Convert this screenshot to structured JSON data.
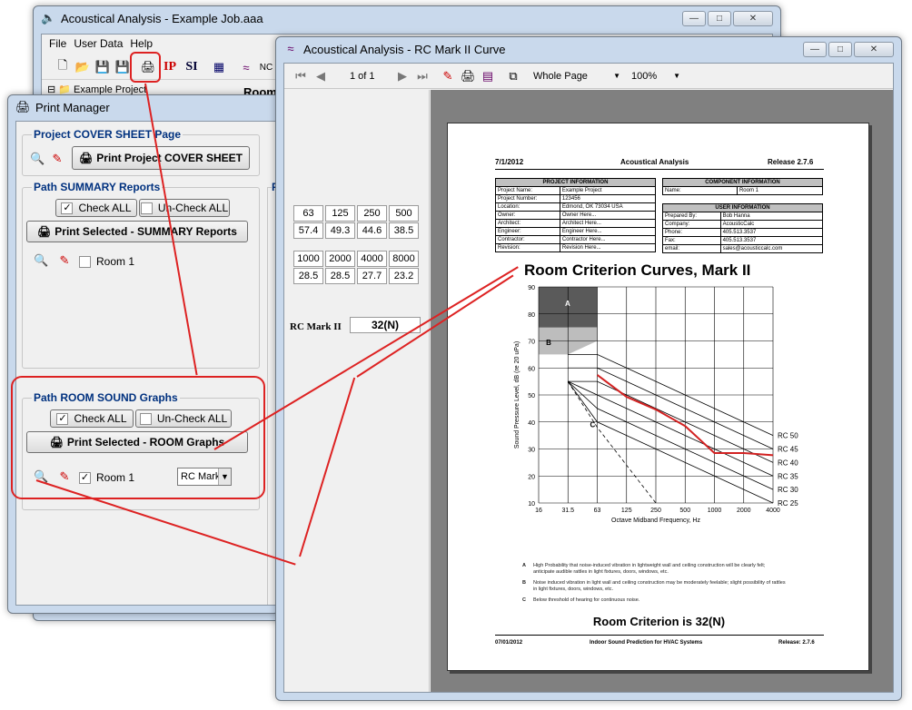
{
  "main_window": {
    "title": "Acoustical Analysis - Example Job.aaa",
    "menu": [
      "File",
      "User Data",
      "Help"
    ],
    "toolbar": {
      "ip": "IP",
      "si": "SI",
      "nc": "NC"
    },
    "tree_item": "Example Project",
    "room_header": "Room"
  },
  "print_manager": {
    "title": "Print Manager",
    "cover": {
      "group": "Project COVER SHEET Page",
      "print": "Print Project COVER SHEET"
    },
    "summary": {
      "group": "Path SUMMARY Reports",
      "check_all": "Check ALL",
      "uncheck_all": "Un-Check ALL",
      "print": "Print Selected - SUMMARY Reports",
      "room": "Room 1"
    },
    "room_sound": {
      "group": "Path ROOM SOUND Graphs",
      "check_all": "Check ALL",
      "uncheck_all": "Un-Check ALL",
      "print": "Print Selected - ROOM Graphs",
      "room": "Room 1",
      "dropdown": "RC Mark"
    },
    "side_group_partial": "P"
  },
  "report_window": {
    "title": "Acoustical Analysis - RC Mark II Curve",
    "page": "1 of 1",
    "view": "Whole Page",
    "zoom": "100%",
    "bands_row1": [
      "63",
      "125",
      "250",
      "500"
    ],
    "values_row1": [
      "57.4",
      "49.3",
      "44.6",
      "38.5"
    ],
    "bands_row2": [
      "1000",
      "2000",
      "4000",
      "8000"
    ],
    "values_row2": [
      "28.5",
      "28.5",
      "27.7",
      "23.2"
    ],
    "rc_label": "RC Mark II",
    "rc_value": "32(N)"
  },
  "report_page": {
    "date": "7/1/2012",
    "header_title": "Acoustical Analysis",
    "release": "Release 2.7.6",
    "project_info": {
      "heading": "PROJECT INFORMATION",
      "rows": [
        [
          "Project Name:",
          "Example Project"
        ],
        [
          "Project Number:",
          "123456"
        ],
        [
          "Location:",
          "Edmond, OK 73034 USA"
        ],
        [
          "Owner:",
          "Owner Here..."
        ],
        [
          "Architect:",
          "Architect Here..."
        ],
        [
          "Engineer:",
          "Engineer Here..."
        ],
        [
          "Contractor:",
          "Contractor Here..."
        ],
        [
          "Revision:",
          "Revision Here..."
        ]
      ]
    },
    "component_info": {
      "heading": "COMPONENT INFORMATION",
      "rows": [
        [
          "Name:",
          "Room 1"
        ]
      ]
    },
    "user_info": {
      "heading": "USER INFORMATION",
      "rows": [
        [
          "Prepared By:",
          "Bob Hanna"
        ],
        [
          "Company:",
          "AcousticCalc"
        ],
        [
          "Phone:",
          "405.513.3537"
        ],
        [
          "Fax:",
          "405.513.3537"
        ],
        [
          "email:",
          "sales@acousticcalc.com"
        ]
      ]
    },
    "chart_title": "Room Criterion Curves, Mark II",
    "notes": [
      {
        "key": "A",
        "text": "High Probability that noise-induced vibration in lightweight wall and ceiling construction will be clearly felt; anticipate audible rattles in light fixtures, doors, windows, etc."
      },
      {
        "key": "B",
        "text": "Noise induced vibration in light wall and ceiling construction may be moderately feelable; slight possibility of rattles in light fixtures, doors, windows, etc."
      },
      {
        "key": "C",
        "text": "Below threshold of hearing for continuous noise."
      }
    ],
    "result": "Room Criterion is 32(N)",
    "footer_date": "07/01/2012",
    "footer_title": "Indoor Sound Prediction for HVAC Systems",
    "footer_release": "Release: 2.7.6"
  },
  "chart_data": {
    "type": "line",
    "title": "Room Criterion Curves, Mark II",
    "xlabel": "Octave Midband Frequency, Hz",
    "ylabel": "Sound Pressure Level, dB (re 20 uPa)",
    "x_ticks": [
      "16",
      "31.5",
      "63",
      "125",
      "250",
      "500",
      "1000",
      "2000",
      "4000"
    ],
    "y_ticks": [
      10,
      20,
      30,
      40,
      50,
      60,
      70,
      80,
      90
    ],
    "ylim": [
      10,
      90
    ],
    "region_labels": [
      "A",
      "B",
      "C"
    ],
    "rc_curves": [
      {
        "name": "RC 50",
        "values": [
          null,
          65,
          65,
          60,
          55,
          50,
          45,
          40,
          35
        ]
      },
      {
        "name": "RC 45",
        "values": [
          null,
          60,
          60,
          55,
          50,
          45,
          40,
          35,
          30
        ]
      },
      {
        "name": "RC 40",
        "values": [
          null,
          55,
          55,
          50,
          45,
          40,
          35,
          30,
          25
        ]
      },
      {
        "name": "RC 35",
        "values": [
          null,
          55,
          50,
          45,
          40,
          35,
          30,
          25,
          20
        ]
      },
      {
        "name": "RC 30",
        "values": [
          null,
          55,
          45,
          40,
          35,
          30,
          25,
          20,
          15
        ]
      },
      {
        "name": "RC 25",
        "values": [
          null,
          55,
          40,
          35,
          30,
          25,
          20,
          15,
          10
        ]
      }
    ],
    "measured": {
      "x_index": [
        2,
        3,
        4,
        5,
        6,
        7,
        8
      ],
      "values": [
        57.4,
        49.3,
        44.6,
        38.5,
        28.5,
        28.5,
        27.7
      ]
    },
    "colors": {
      "measured": "#d22222",
      "grid": "#000000",
      "region_a": "#5a5a5a",
      "region_b": "#bdbdbd"
    },
    "grid": true
  }
}
